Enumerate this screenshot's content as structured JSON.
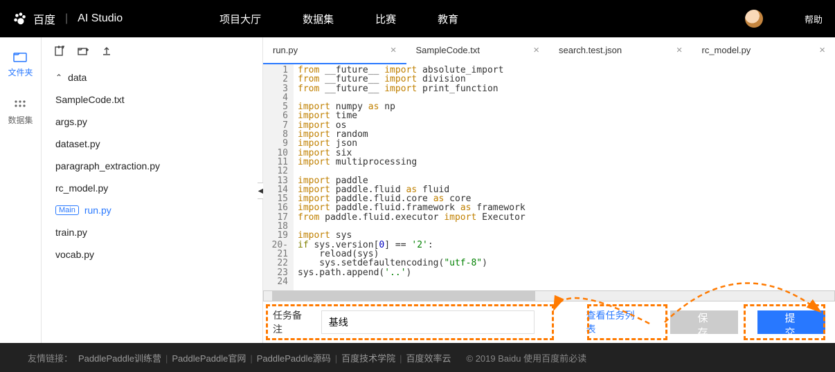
{
  "header": {
    "brand_cn": "百度",
    "brand_studio": "AI Studio",
    "nav": [
      "项目大厅",
      "数据集",
      "比赛",
      "教育"
    ],
    "help": "帮助"
  },
  "rail": {
    "files": "文件夹",
    "datasets": "数据集"
  },
  "tree": {
    "folder": "data",
    "items": [
      "SampleCode.txt",
      "args.py",
      "dataset.py",
      "paragraph_extraction.py",
      "rc_model.py"
    ],
    "main_badge": "Main",
    "main_file": "run.py",
    "items2": [
      "train.py",
      "vocab.py"
    ]
  },
  "tabs": [
    {
      "label": "run.py",
      "active": true
    },
    {
      "label": "SampleCode.txt",
      "active": false
    },
    {
      "label": "search.test.json",
      "active": false
    },
    {
      "label": "rc_model.py",
      "active": false
    }
  ],
  "code": {
    "lines": [
      {
        "n": 1,
        "html": "<span class='kw'>from</span> __future__ <span class='kw'>import</span> absolute_import"
      },
      {
        "n": 2,
        "html": "<span class='kw'>from</span> __future__ <span class='kw'>import</span> division"
      },
      {
        "n": 3,
        "html": "<span class='kw'>from</span> __future__ <span class='kw'>import</span> print_function"
      },
      {
        "n": 4,
        "html": ""
      },
      {
        "n": 5,
        "html": "<span class='kw'>import</span> numpy <span class='kw'>as</span> np"
      },
      {
        "n": 6,
        "html": "<span class='kw'>import</span> time"
      },
      {
        "n": 7,
        "html": "<span class='kw'>import</span> os"
      },
      {
        "n": 8,
        "html": "<span class='kw'>import</span> random"
      },
      {
        "n": 9,
        "html": "<span class='kw'>import</span> json"
      },
      {
        "n": 10,
        "html": "<span class='kw'>import</span> six"
      },
      {
        "n": 11,
        "html": "<span class='kw'>import</span> multiprocessing"
      },
      {
        "n": 12,
        "html": ""
      },
      {
        "n": 13,
        "html": "<span class='kw'>import</span> paddle"
      },
      {
        "n": 14,
        "html": "<span class='kw'>import</span> paddle.fluid <span class='kw'>as</span> fluid"
      },
      {
        "n": 15,
        "html": "<span class='kw'>import</span> paddle.fluid.core <span class='kw'>as</span> core"
      },
      {
        "n": 16,
        "html": "<span class='kw'>import</span> paddle.fluid.framework <span class='kw'>as</span> framework"
      },
      {
        "n": 17,
        "html": "<span class='kw'>from</span> paddle.fluid.executor <span class='kw'>import</span> Executor"
      },
      {
        "n": 18,
        "html": ""
      },
      {
        "n": 19,
        "html": "<span class='kw'>import</span> sys"
      },
      {
        "n": 20,
        "html": "<span class='kw2'>if</span> sys.version[<span class='num'>0</span>] == <span class='str'>'2'</span>:",
        "marker": "-"
      },
      {
        "n": 21,
        "html": "    reload(sys)"
      },
      {
        "n": 22,
        "html": "    sys.setdefaultencoding(<span class='str'>\"utf-8\"</span>)"
      },
      {
        "n": 23,
        "html": "sys.path.append(<span class='str'>'..'</span>)"
      },
      {
        "n": 24,
        "html": ""
      }
    ]
  },
  "bottom": {
    "task_label": "任务备注",
    "task_value": "基线",
    "view_tasks": "查看任务列表",
    "save": "保 存",
    "submit": "提 交"
  },
  "footer": {
    "prefix": "友情链接：",
    "links": [
      "PaddlePaddle训练营",
      "PaddlePaddle官网",
      "PaddlePaddle源码",
      "百度技术学院",
      "百度效率云"
    ],
    "copyright": "© 2019 Baidu 使用百度前必读"
  }
}
